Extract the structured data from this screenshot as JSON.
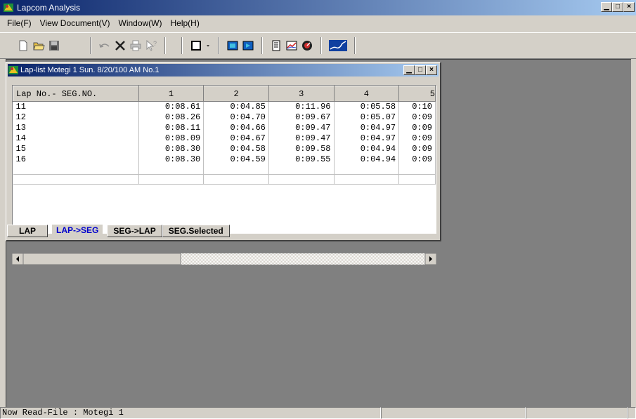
{
  "app": {
    "title": "Lapcom Analysis"
  },
  "menubar": [
    "File(F)",
    "View Document(V)",
    "Window(W)",
    "Help(H)"
  ],
  "child_window": {
    "title": "Lap-list  Motegi 1  Sun. 8/20/100 AM  No.1"
  },
  "grid": {
    "header": [
      "Lap No.- SEG.NO.",
      "1",
      "2",
      "3",
      "4",
      "5"
    ],
    "rows": [
      [
        "11",
        "0:08.61",
        "0:04.85",
        "0:11.96",
        "0:05.58",
        "0:10"
      ],
      [
        "12",
        "0:08.26",
        "0:04.70",
        "0:09.67",
        "0:05.07",
        "0:09"
      ],
      [
        "13",
        "0:08.11",
        "0:04.66",
        "0:09.47",
        "0:04.97",
        "0:09"
      ],
      [
        "14",
        "0:08.09",
        "0:04.67",
        "0:09.47",
        "0:04.97",
        "0:09"
      ],
      [
        "15",
        "0:08.30",
        "0:04.58",
        "0:09.58",
        "0:04.94",
        "0:09"
      ],
      [
        "16",
        "0:08.30",
        "0:04.59",
        "0:09.55",
        "0:04.94",
        "0:09"
      ]
    ]
  },
  "tabs": [
    {
      "label": "LAP",
      "active": false
    },
    {
      "label": "LAP->SEG",
      "active": true
    },
    {
      "label": "SEG->LAP",
      "active": false
    },
    {
      "label": "SEG.Selected",
      "active": false
    }
  ],
  "statusbar": {
    "text": "Now Read-File : Motegi 1"
  },
  "colors": {
    "titlebar_start": "#0a246a",
    "titlebar_end": "#a6caf0",
    "active_tab": "#0000cc",
    "workspace": "#808080"
  }
}
